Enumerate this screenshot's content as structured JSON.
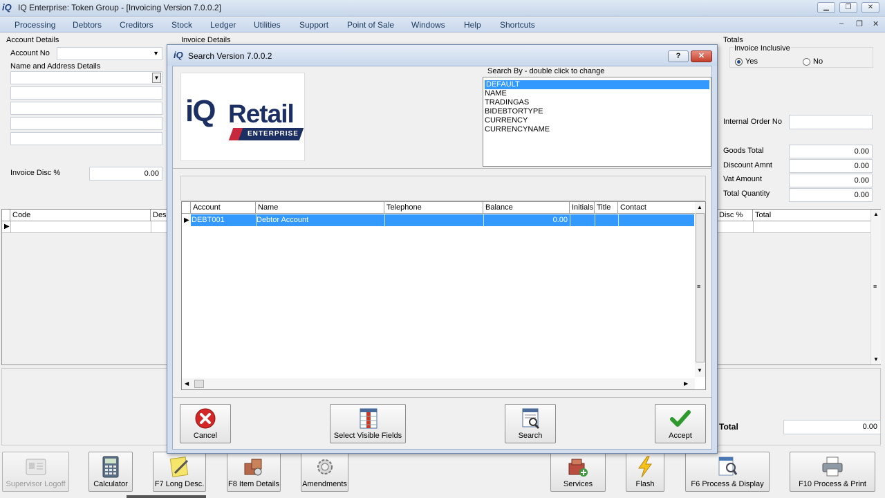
{
  "window": {
    "logo": "iQ",
    "title": "IQ Enterprise: Token Group - [Invoicing Version 7.0.0.2]",
    "min": "▁",
    "max": "❐",
    "close": "✕"
  },
  "menu": [
    "Processing",
    "Debtors",
    "Creditors",
    "Stock",
    "Ledger",
    "Utilities",
    "Support",
    "Point of Sale",
    "Windows",
    "Help",
    "Shortcuts"
  ],
  "mdi": {
    "min": "–",
    "restore": "❐",
    "close": "✕"
  },
  "account": {
    "section": "Account Details",
    "account_no_label": "Account No",
    "name_address_label": "Name and Address Details",
    "invoice_disc_label": "Invoice Disc %",
    "invoice_disc_value": "0.00"
  },
  "invoice_details_label": "Invoice Details",
  "totals": {
    "section": "Totals",
    "inclusive_label": "Invoice Inclusive",
    "yes": "Yes",
    "no": "No",
    "internal_order_label": "Internal Order No",
    "goods_total_label": "Goods Total",
    "goods_total": "0.00",
    "discount_label": "Discount Amnt",
    "discount": "0.00",
    "vat_label": "Vat Amount",
    "vat": "0.00",
    "qty_label": "Total Quantity",
    "qty": "0.00",
    "total_label": "Total",
    "total": "0.00"
  },
  "lines_grid": {
    "code": "Code",
    "desc": "Desc",
    "disc": "Disc %",
    "total": "Total"
  },
  "dialog": {
    "logo": "iQ",
    "title": "Search Version 7.0.0.2",
    "help": "?",
    "close": "✕",
    "brand_iq": "iQ",
    "brand_retail": "Retail",
    "brand_enterprise": "ENTERPRISE",
    "search_by_label": "Search By - double click to change",
    "search_by_options": [
      "DEFAULT",
      "NAME",
      "TRADINGAS",
      "BIDEBTORTYPE",
      "CURRENCY",
      "CURRENCYNAME"
    ],
    "columns": [
      "Account",
      "Name",
      "Telephone",
      "Balance",
      "Initials",
      "Title",
      "Contact"
    ],
    "rows": [
      {
        "account": "DEBT001",
        "name": "Debtor Account",
        "telephone": "",
        "balance": "0.00",
        "initials": "",
        "title": "",
        "contact": ""
      }
    ],
    "buttons": {
      "cancel": "Cancel",
      "select_fields": "Select Visible Fields",
      "search": "Search",
      "accept": "Accept"
    }
  },
  "bottom_buttons": {
    "supervisor": "Supervisor Logoff",
    "calculator": "Calculator",
    "long_desc": "F7 Long Desc.",
    "item_details": "F8 Item Details",
    "amendments": "Amendments",
    "services": "Services",
    "flash": "Flash",
    "process_display": "F6 Process & Display",
    "process_print": "F10 Process & Print"
  },
  "colors": {
    "selection": "#3399ff",
    "accent": "#1e395b",
    "cancel_red": "#d42626",
    "accept_green": "#2e9a2e"
  }
}
